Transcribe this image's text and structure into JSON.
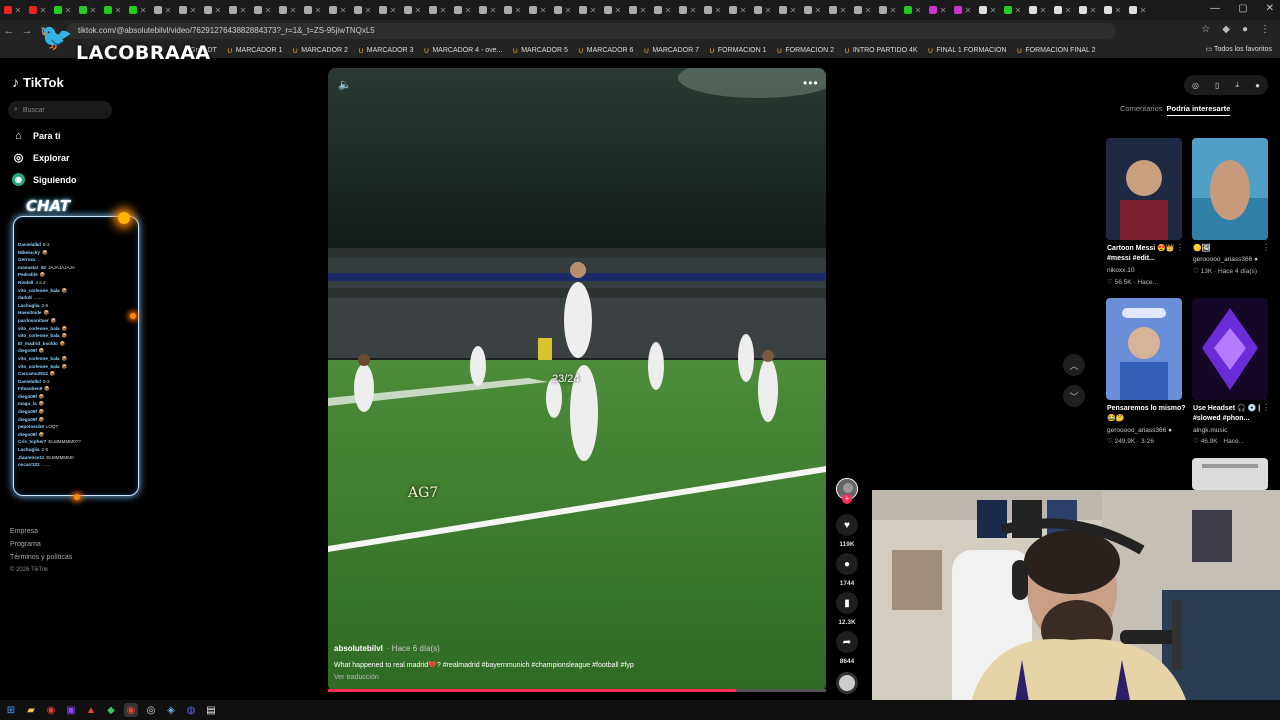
{
  "browser": {
    "url": "tiktok.com/@absolutebilvl/video/7629127643882884373?_r=1&_t=ZS-95jiwTNQxL5",
    "bookmarks": [
      "Gran DT",
      "MARCADOR 1",
      "MARCADOR 2",
      "MARCADOR 3",
      "MARCADOR 4 - ove...",
      "MARCADOR 5",
      "MARCADOR 6",
      "MARCADOR 7",
      "FORMACION 1",
      "FORMACION 2",
      "INTRO PARTIDO 4K",
      "FINAL 1 FORMACION",
      "FORMACION FINAL 2"
    ],
    "all_favorites": "Todos los favoritos"
  },
  "stream": {
    "logo_text": "LACOBRAAA",
    "chat_title": "CHAT",
    "chat_messages": [
      {
        "user": "Danielalkd",
        "text": "8-2"
      },
      {
        "user": "Mikelucky",
        "text": "📦"
      },
      {
        "user": "Gerroxx",
        "text": "..."
      },
      {
        "user": "manuelar_62",
        "text": "JAJAJAJAJA"
      },
      {
        "user": "Pedrolite",
        "text": "📦"
      },
      {
        "user": "Rindell",
        "text": "4 a 2"
      },
      {
        "user": "vito_corleone_bala",
        "text": "📦"
      },
      {
        "user": "darkdl",
        "text": "........"
      },
      {
        "user": "Lachuglia",
        "text": "2-6"
      },
      {
        "user": "Huevitoide",
        "text": "📦"
      },
      {
        "user": "pardosonitxer",
        "text": "📦"
      },
      {
        "user": "vito_corleone_bala",
        "text": "📦"
      },
      {
        "user": "vito_corleone_bala",
        "text": "📦"
      },
      {
        "user": "El_madrid_bsoldo",
        "text": "📦"
      },
      {
        "user": "diego09f",
        "text": "📦"
      },
      {
        "user": "vito_corleone_bala",
        "text": "📦"
      },
      {
        "user": "vito_corleone_bala",
        "text": "📦"
      },
      {
        "user": "Carcamo2912",
        "text": "📦"
      },
      {
        "user": "Danielalkd",
        "text": "8-2"
      },
      {
        "user": "Fdsaoben9",
        "text": "📦"
      },
      {
        "user": "diego09f",
        "text": "📦"
      },
      {
        "user": "magu_la",
        "text": "📦"
      },
      {
        "user": "diego09f",
        "text": "📦"
      },
      {
        "user": "diego09f",
        "text": "📦"
      },
      {
        "user": "pepotoecb9",
        "text": "LOQT"
      },
      {
        "user": "diego09f",
        "text": "📦"
      },
      {
        "user": "Cris_topher7",
        "text": "ELMMMMM0??"
      },
      {
        "user": "Lachuglia",
        "text": "2-0"
      },
      {
        "user": "Jlaurence11",
        "text": "ELMMMMM0"
      },
      {
        "user": "oscarr322",
        "text": "......."
      }
    ]
  },
  "tiktok": {
    "logo": "TikTok",
    "search_placeholder": "Buscar",
    "nav": [
      {
        "label": "Para ti",
        "icon": "home-icon"
      },
      {
        "label": "Explorar",
        "icon": "compass-icon"
      },
      {
        "label": "Siguiendo",
        "icon": "following-icon"
      }
    ],
    "footer": [
      "Empresa",
      "Programa",
      "Términos y políticas",
      "© 2026 TikTok"
    ]
  },
  "video": {
    "author": "absolutebilvl",
    "ago": "· Hace 6 día(s)",
    "description": "What happened to real madrid💔? #realmadrid #bayernmunich #championsleague #football #fyp",
    "translate": "Ver traducción",
    "overlay_season": "23/24",
    "overlay_tag": "AG7",
    "progress": 0.82
  },
  "actions": {
    "likes": "119K",
    "comments": "1744",
    "saves": "12.3K",
    "shares": "8644"
  },
  "panel": {
    "tabs": [
      "Comentarios",
      "Podría interesarte"
    ],
    "active_tab": 1,
    "cards": [
      {
        "title": "Cartoon Messi 😍👑#messi #edit...",
        "author": "nikoxx.10",
        "stats": "♡ 56.5K · Hace..."
      },
      {
        "title": "🟡🖼",
        "author": "gerooooo_ariass366 ●",
        "stats": "♡ 13K · Hace 4 día(s)"
      },
      {
        "title": "Pensaremos lo mismo? 😂🤔",
        "author": "gerooooo_ariass366 ●",
        "stats": "♡ 249.9K · 3-26"
      },
      {
        "title": "Use Headset 🎧 💿 | #slowed #phon...",
        "author": "alngk.music",
        "stats": "♡ 46.9K · Hace..."
      }
    ]
  },
  "colors": {
    "accent": "#fe2c55",
    "chat_glow": "#7fc7ff",
    "bookmark_icon": "#f2a33a"
  }
}
